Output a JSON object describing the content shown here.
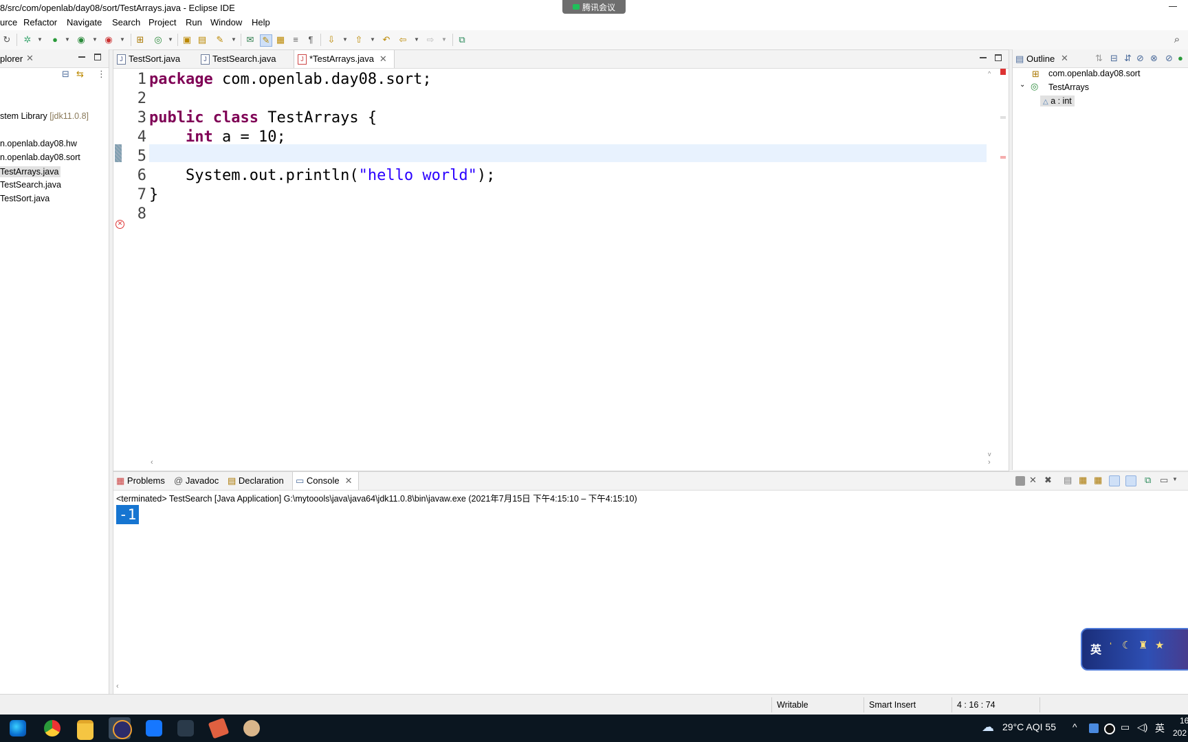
{
  "window": {
    "title": "8/src/com/openlab/day08/sort/TestArrays.java - Eclipse IDE",
    "meeting_label": "腾讯会议"
  },
  "menus": [
    "urce",
    "Refactor",
    "Navigate",
    "Search",
    "Project",
    "Run",
    "Window",
    "Help"
  ],
  "explorer": {
    "title": "plorer",
    "items": [
      "stem Library",
      "[jdk11.0.8]",
      "n.openlab.day08.hw",
      "n.openlab.day08.sort",
      "TestArrays.java",
      "TestSearch.java",
      "TestSort.java"
    ]
  },
  "editor": {
    "tabs": [
      "TestSort.java",
      "TestSearch.java",
      "*TestArrays.java"
    ],
    "line_numbers": [
      "1",
      "2",
      "3",
      "4",
      "5",
      "6",
      "7",
      "8"
    ],
    "line1": {
      "kw": "package",
      "rest": " com.openlab.day08.sort;"
    },
    "line3": {
      "kw1": "public",
      "kw2": "class",
      "rest": " TestArrays {"
    },
    "line4": {
      "kw": "int",
      "rest": " a = 10;"
    },
    "line6": {
      "pre": "    System.out.println(",
      "str": "\"hello world\"",
      "post": ");"
    },
    "line7": {
      "text": "}"
    }
  },
  "outline": {
    "title": "Outline",
    "items": [
      "com.openlab.day08.sort",
      "TestArrays",
      "a : int"
    ]
  },
  "console": {
    "tabs": [
      "Problems",
      "Javadoc",
      "Declaration",
      "Console"
    ],
    "description": "<terminated> TestSearch [Java Application] G:\\mytoools\\java\\java64\\jdk11.0.8\\bin\\javaw.exe  (2021年7月15日 下午4:15:10 – 下午4:15:10)",
    "output": "-1"
  },
  "status": {
    "writable": "Writable",
    "insert_mode": "Smart Insert",
    "position": "4 : 16 : 74"
  },
  "ime": {
    "label": "英"
  },
  "taskbar": {
    "weather": "29°C  AQI 55",
    "ime_indicator": "英",
    "clock_top": "16",
    "clock_bottom": "202"
  }
}
